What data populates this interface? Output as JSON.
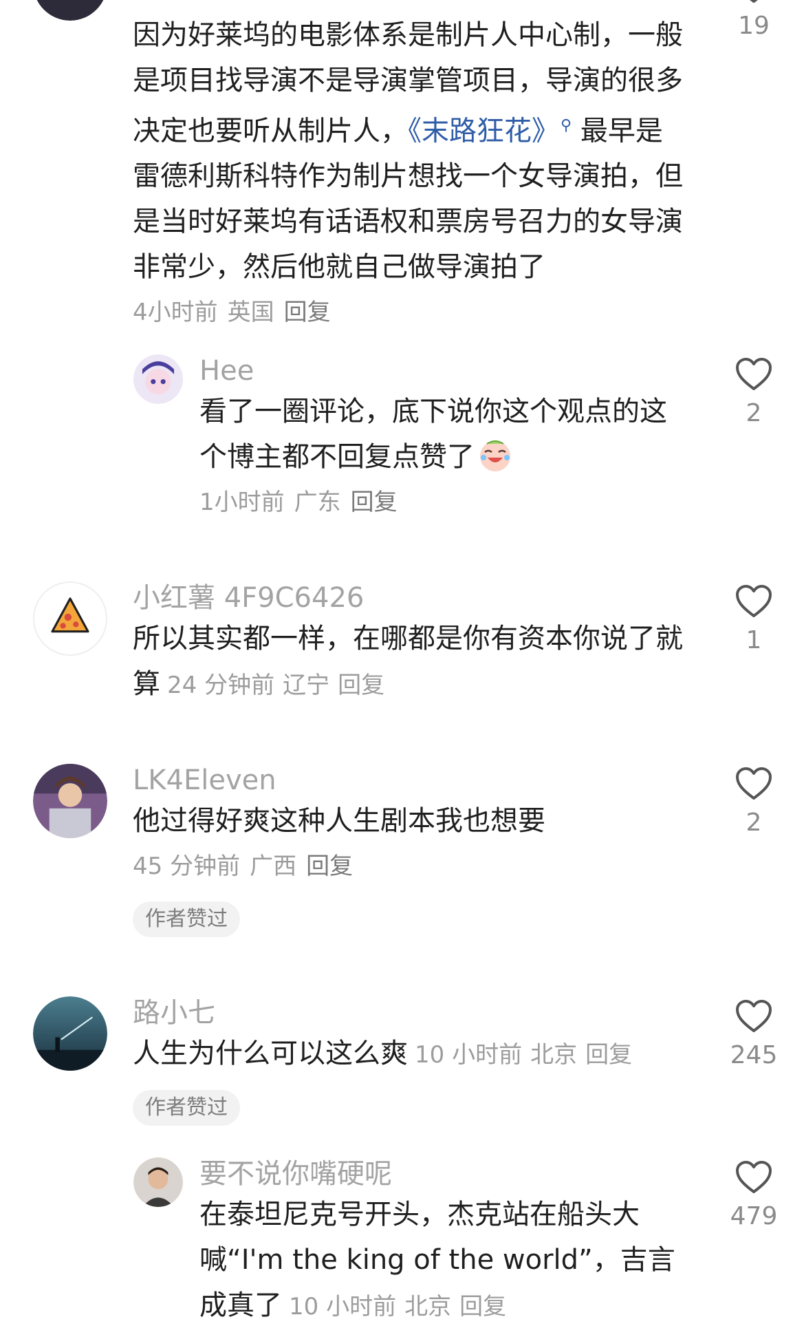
{
  "comments": [
    {
      "text_a": "因为好莱坞的电影体系是制片人中心制，一般是项目找导演不是导演掌管项目，导演的很多决定也要听从制片人，",
      "link_text": "《末路狂花》",
      "link_icon": "search-icon",
      "text_b": "最早是雷德利斯科特作为制片想找一个女导演拍，但是当时好莱坞有话语权和票房号召力的女导演非常少，然后他就自己做导演拍了",
      "time": "4小时前",
      "location": "英国",
      "reply_label": "回复",
      "likes": "19"
    },
    {
      "username": "Hee",
      "text": "看了一圈评论，底下说你这个观点的这个博主都不回复点赞了",
      "emoji": "laughing-crying-emoji",
      "time": "1小时前",
      "location": "广东",
      "reply_label": "回复",
      "likes": "2"
    },
    {
      "username": "小红薯 4F9C6426",
      "text": "所以其实都一样，在哪都是你有资本你说了就算",
      "time": "24 分钟前",
      "location": "辽宁",
      "reply_label": "回复",
      "likes": "1"
    },
    {
      "username": "LK4Eleven",
      "text": "他过得好爽这种人生剧本我也想要",
      "time": "45 分钟前",
      "location": "广西",
      "reply_label": "回复",
      "tag": "作者赞过",
      "likes": "2"
    },
    {
      "username": "路小七",
      "text": "人生为什么可以这么爽",
      "time": "10 小时前",
      "location": "北京",
      "reply_label": "回复",
      "tag": "作者赞过",
      "likes": "245"
    },
    {
      "username": "要不说你嘴硬呢",
      "text": "在泰坦尼克号开头，杰克站在船头大喊“I'm the king of the world”，吉言成真了",
      "time": "10 小时前",
      "location": "北京",
      "reply_label": "回复",
      "likes": "479"
    }
  ],
  "colors": {
    "link": "#2f5da8",
    "secondary_text": "#9c9c9c",
    "username": "#a3a3a3",
    "tag_bg": "#f2f2f2"
  },
  "icons": {
    "like": "heart-outline-icon"
  }
}
